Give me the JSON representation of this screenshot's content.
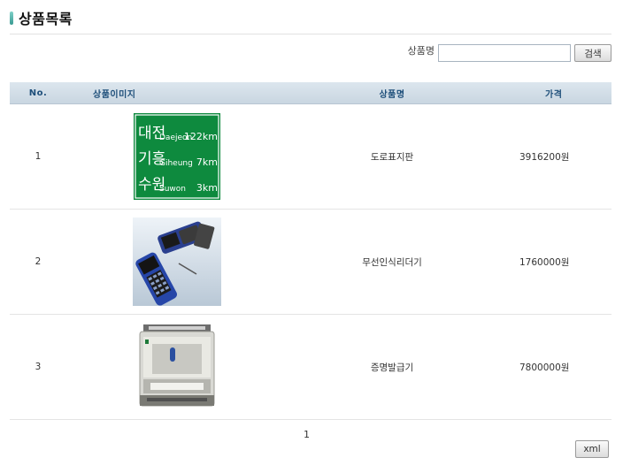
{
  "page": {
    "title": "상품목록"
  },
  "search": {
    "label": "상품명",
    "value": "",
    "placeholder": "",
    "button_label": "검색"
  },
  "table": {
    "headers": {
      "no": "No.",
      "image": "상품이미지",
      "name": "상품명",
      "price": "가격"
    },
    "rows": [
      {
        "no": "1",
        "image_icon": "road-sign-image",
        "sign_lines": [
          {
            "ko": "대전",
            "en": "Daejeon",
            "dist": "122km"
          },
          {
            "ko": "기흥",
            "en": "Giheung",
            "dist": "7km"
          },
          {
            "ko": "수원",
            "en": "Suwon",
            "dist": "3km"
          }
        ],
        "name": "도로표지판",
        "price": "3916200원"
      },
      {
        "no": "2",
        "image_icon": "wireless-reader-image",
        "name": "무선인식리더기",
        "price": "1760000원"
      },
      {
        "no": "3",
        "image_icon": "certificate-issuer-image",
        "name": "증명발급기",
        "price": "7800000원"
      }
    ]
  },
  "pagination": {
    "current": "1"
  },
  "export": {
    "xml_label": "xml"
  },
  "colors": {
    "header_bg": "#c9d6e1",
    "header_text": "#1e4f7a",
    "sign_green": "#0e8a3e"
  }
}
